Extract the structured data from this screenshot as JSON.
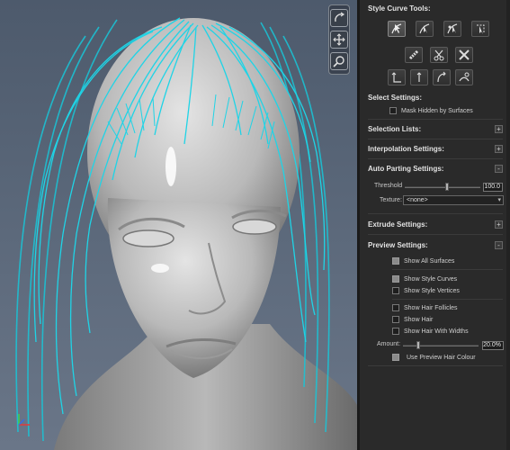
{
  "viewport": {
    "tools": [
      {
        "name": "rotate-view-icon"
      },
      {
        "name": "pan-view-icon"
      },
      {
        "name": "zoom-view-icon"
      }
    ],
    "hair_color": "#1fd4e6",
    "skin_color": "#bfbfbf"
  },
  "panel": {
    "style_curve_tools": {
      "title": "Style Curve Tools:",
      "tools_row1": [
        "curve-select-icon",
        "curve-brush-icon",
        "curve-move-icon",
        "curve-lasso-icon"
      ],
      "tools_row2": [
        "comb-icon",
        "scissors-icon",
        "cross-tools-icon"
      ],
      "tools_row3": [
        "straighten-icon",
        "lengthen-icon",
        "bend-icon",
        "frizz-icon"
      ]
    },
    "select_settings": {
      "title": "Select Settings:",
      "mask_hidden": {
        "label": "Mask Hidden by Surfaces",
        "checked": false
      }
    },
    "selection_lists": {
      "title": "Selection Lists:",
      "toggle": "+"
    },
    "interpolation_settings": {
      "title": "Interpolation Settings:",
      "toggle": "+"
    },
    "auto_parting": {
      "title": "Auto Parting Settings:",
      "toggle": "-",
      "threshold_label": "Threshold",
      "threshold_value": "100.0",
      "threshold_fraction": 0.56,
      "texture_label": "Texture:",
      "texture_value": "<none>"
    },
    "extrude_settings": {
      "title": "Extrude Settings:",
      "toggle": "+"
    },
    "preview_settings": {
      "title": "Preview Settings:",
      "toggle": "-",
      "show_all_surfaces": {
        "label": "Show All Surfaces",
        "checked": true
      },
      "show_style_curves": {
        "label": "Show Style Curves",
        "checked": true
      },
      "show_style_vertices": {
        "label": "Show Style Vertices",
        "checked": false
      },
      "show_hair_follicles": {
        "label": "Show Hair Follicles",
        "checked": false
      },
      "show_hair": {
        "label": "Show Hair",
        "checked": false
      },
      "show_hair_with_widths": {
        "label": "Show Hair With Widths",
        "checked": false
      },
      "amount_label": "Amount:",
      "amount_value": "20.0%",
      "amount_fraction": 0.2,
      "use_preview_colour": {
        "label": "Use Preview Hair Colour",
        "checked": true
      }
    }
  }
}
